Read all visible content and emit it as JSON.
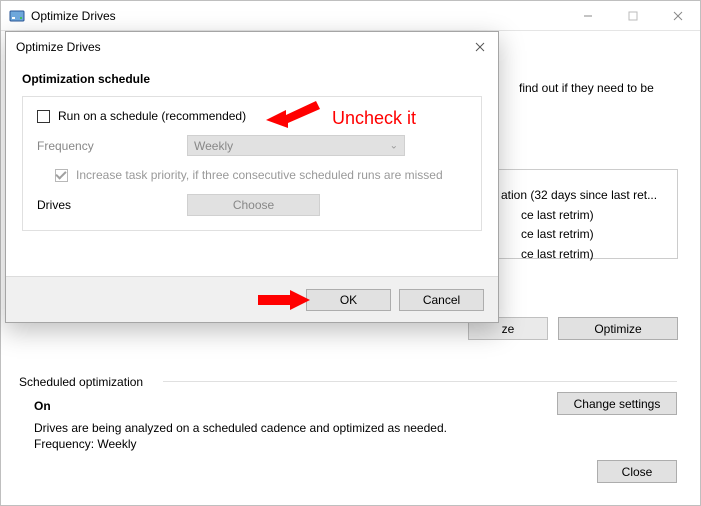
{
  "parent": {
    "title": "Optimize Drives",
    "desc_fragment": "find out if they need to be",
    "drive_status": {
      "r1": "ation (32 days since last ret...",
      "r2": "ce last retrim)",
      "r3": "ce last retrim)",
      "r4": "ce last retrim)"
    },
    "mid_buttons": {
      "analyze_like": "ze",
      "optimize": "Optimize"
    },
    "section_scheduled": "Scheduled optimization",
    "scheduled": {
      "on": "On",
      "desc": "Drives are being analyzed on a scheduled cadence and optimized as needed.",
      "freq": "Frequency: Weekly"
    },
    "change_settings": "Change settings",
    "close": "Close"
  },
  "modal": {
    "title": "Optimize Drives",
    "section": "Optimization schedule",
    "run_schedule_label": "Run on a schedule (recommended)",
    "run_schedule_checked": false,
    "frequency_label": "Frequency",
    "frequency_value": "Weekly",
    "priority_label": "Increase task priority, if three consecutive scheduled runs are missed",
    "priority_checked": true,
    "drives_label": "Drives",
    "choose": "Choose",
    "ok": "OK",
    "cancel": "Cancel"
  },
  "annotations": {
    "uncheck_text": "Uncheck it"
  }
}
